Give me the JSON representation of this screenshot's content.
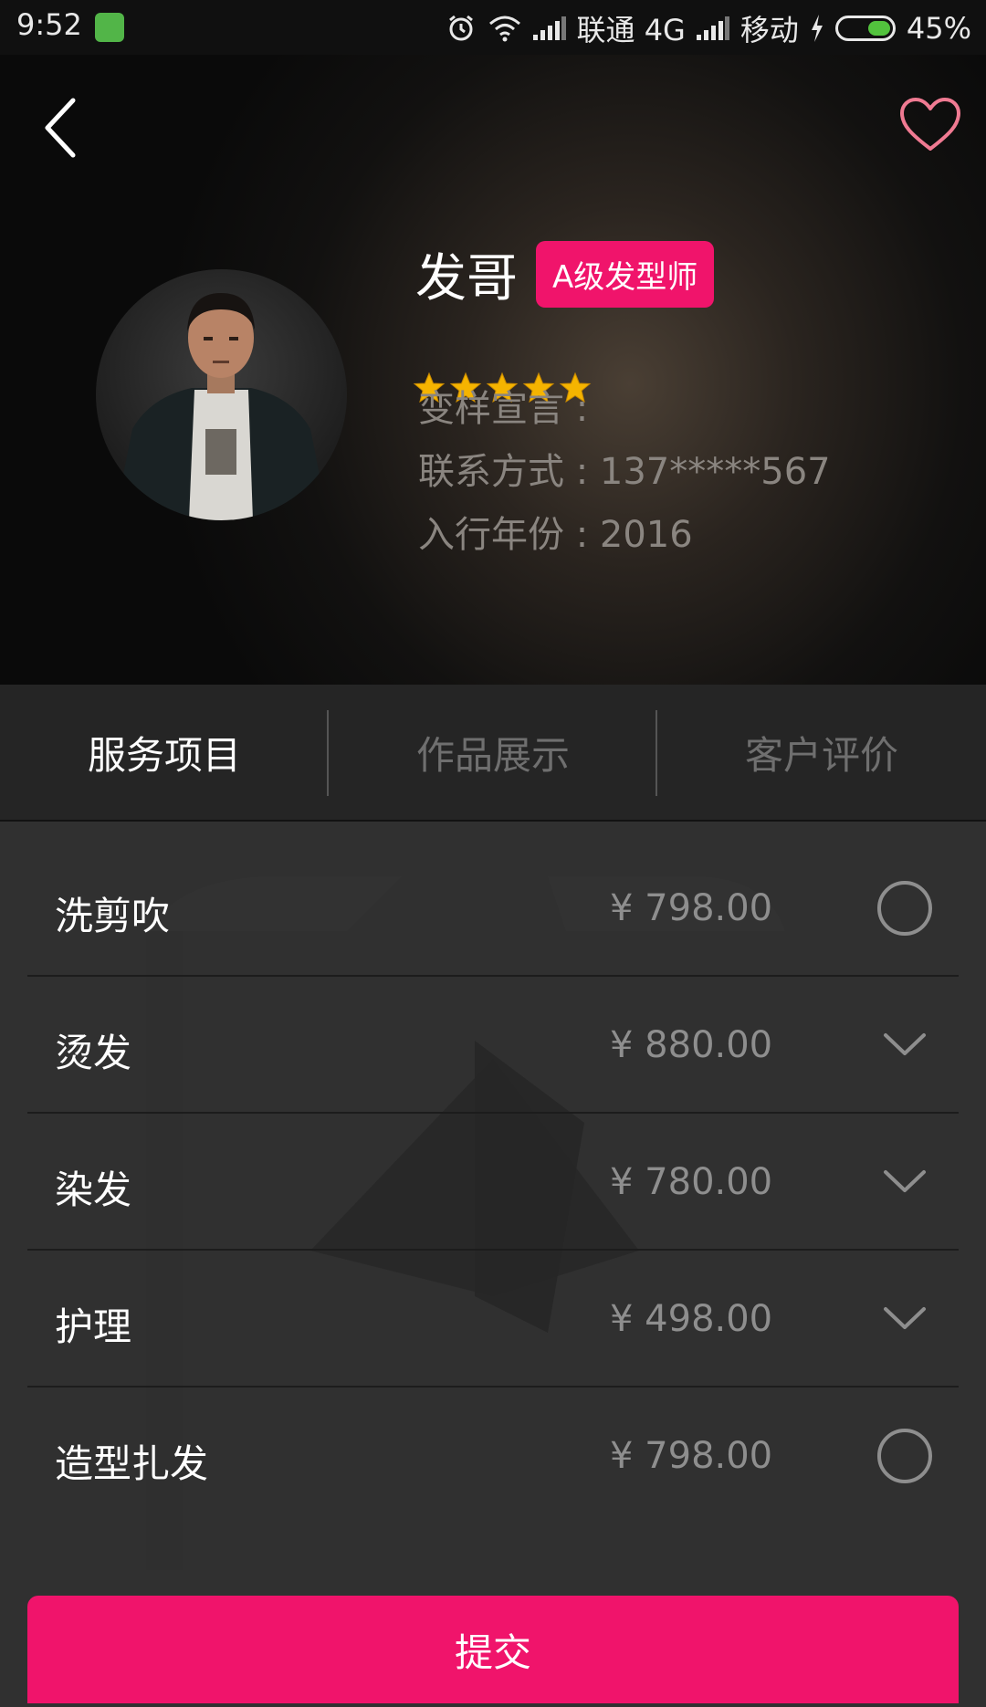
{
  "status_bar": {
    "time": "9:52",
    "carrier1": "联通 4G",
    "carrier2": "移动",
    "battery": "45%",
    "battery_level": 0.45
  },
  "stylist": {
    "name": "发哥",
    "level": "A级发型师",
    "rating": 5,
    "max_rating": 5,
    "motto": "变样宣言 :",
    "contact": "联系方式 : 137*****567",
    "since": "入行年份 : 2016"
  },
  "tabs": [
    {
      "label": "服务项目",
      "active": true
    },
    {
      "label": "作品展示",
      "active": false
    },
    {
      "label": "客户评价",
      "active": false
    }
  ],
  "services": [
    {
      "name": "洗剪吹",
      "price": "¥ 798.00",
      "control": "radio"
    },
    {
      "name": "烫发",
      "price": "¥ 880.00",
      "control": "dropdown"
    },
    {
      "name": "染发",
      "price": "¥ 780.00",
      "control": "dropdown"
    },
    {
      "name": "护理",
      "price": "¥ 498.00",
      "control": "dropdown"
    },
    {
      "name": "造型扎发",
      "price": "¥ 798.00",
      "control": "radio"
    }
  ],
  "submit_label": "提交",
  "colors": {
    "accent": "#f0146b",
    "star": "#f5b400",
    "heart": "#f07a92"
  }
}
